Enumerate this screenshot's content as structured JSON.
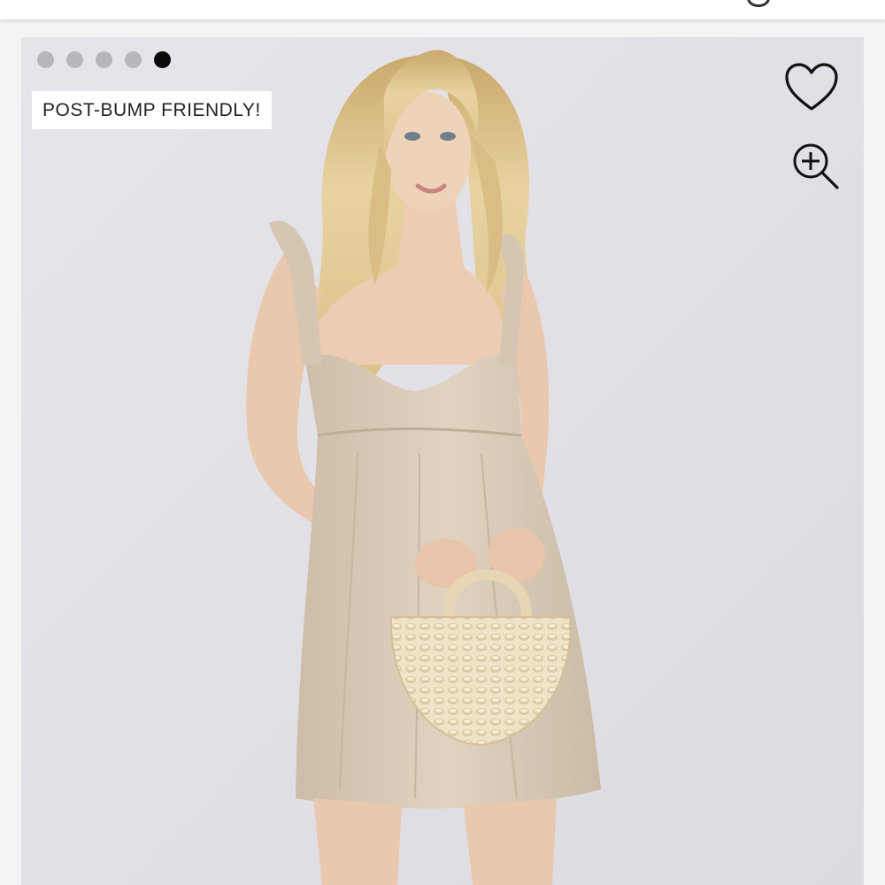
{
  "header": {
    "partial_icon": "search-icon"
  },
  "gallery": {
    "badge": "POST-BUMP FRIENDLY!",
    "dots_total": 5,
    "dots_active": 5,
    "photo_description_icon": "product-photo",
    "actions": [
      {
        "icon": "heart-icon"
      },
      {
        "icon": "zoom-in-icon"
      }
    ]
  },
  "colors": {
    "background": "#e4e3e8",
    "dot_inactive": "#b7b7bb",
    "dot_active": "#0a0a0a",
    "badge_bg": "#ffffff",
    "dress": "#d9cbb8",
    "hair": "#e2c98e",
    "bag": "#ece0c6"
  }
}
